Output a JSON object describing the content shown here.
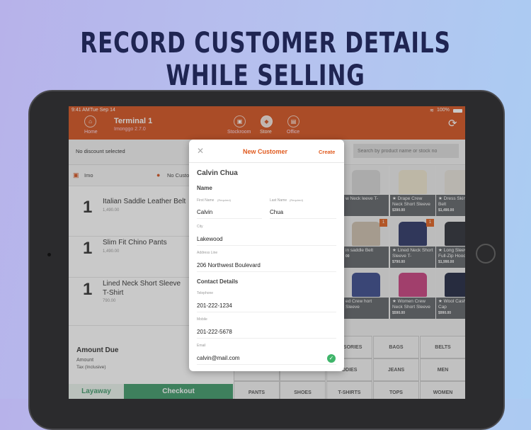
{
  "headline": "RECORD CUSTOMER DETAILS WHILE SELLING",
  "status": {
    "time": "9:41 AM",
    "date": "Tue Sep 14",
    "battery": "100%"
  },
  "topbar": {
    "home": "Home",
    "terminal": "Terminal 1",
    "version": "Imonggo 2.7.0",
    "nav": [
      "Stockroom",
      "Store",
      "Office"
    ]
  },
  "subbar": {
    "discount": "No discount selected",
    "search_placeholder": "Search by product name or stock no"
  },
  "cart": {
    "user": "Imo",
    "customer": "No Custo",
    "items": [
      {
        "qty": "1",
        "name": "Italian Saddle Leather Belt",
        "price": "1,490.00"
      },
      {
        "qty": "1",
        "name": "Slim Fit Chino Pants",
        "price": "1,490.00"
      },
      {
        "qty": "1",
        "name": "Lined Neck Short Sleeve T-Shirt",
        "price": "790.00"
      }
    ],
    "amount_due": "Amount Due",
    "amount": "Amount",
    "tax": "Tax (Inclusive)",
    "layaway": "Layaway",
    "checkout": "Checkout"
  },
  "products": [
    {
      "name": "w Neck leeve T-",
      "price": "",
      "badge": ""
    },
    {
      "name": "★ Drape Crew Neck Short Sleeve",
      "price": "$390.00",
      "badge": ""
    },
    {
      "name": "★ Dress Skinny Belt",
      "price": "$1,490.00",
      "badge": ""
    },
    {
      "name": "in saddle Belt",
      "price": "00",
      "badge": "1"
    },
    {
      "name": "★ Lined Neck Short Sleeve T-",
      "price": "$790.00",
      "badge": "1"
    },
    {
      "name": "★ Long Sleeve Full-Zip Hoodie",
      "price": "$1,990.00",
      "badge": ""
    },
    {
      "name": "ed Crew hort Sleeve",
      "price": "",
      "badge": ""
    },
    {
      "name": "★ Women Crew Neck Short Sleeve",
      "price": "$590.00",
      "badge": ""
    },
    {
      "name": "★ Wool Cashmere Cap",
      "price": "$990.00",
      "badge": ""
    }
  ],
  "categories": [
    [
      "",
      "",
      "ESSORIES",
      "BAGS",
      "BELTS"
    ],
    [
      "",
      "",
      "ODIES",
      "JEANS",
      "MEN"
    ],
    [
      "PANTS",
      "SHOES",
      "T-SHIRTS",
      "TOPS",
      "WOMEN"
    ]
  ],
  "modal": {
    "title": "New Customer",
    "create": "Create",
    "customer_name": "Calvin Chua",
    "name_section": "Name",
    "first_name_label": "First Name",
    "last_name_label": "Last Name",
    "required": "(Required)",
    "first_name": "Calvin",
    "last_name": "Chua",
    "city_label": "City",
    "city": "Lakewood",
    "address_label": "Address Line",
    "address": "206 Northwest Boulevard",
    "contact_section": "Contact Details",
    "telephone_label": "Telephone",
    "telephone": "201-222-1234",
    "mobile_label": "Mobile",
    "mobile": "201-222-5678",
    "email_label": "Email",
    "email": "calvin@mail.com"
  },
  "colors": {
    "brand": "#d5531f",
    "green": "#3f9a6a"
  }
}
